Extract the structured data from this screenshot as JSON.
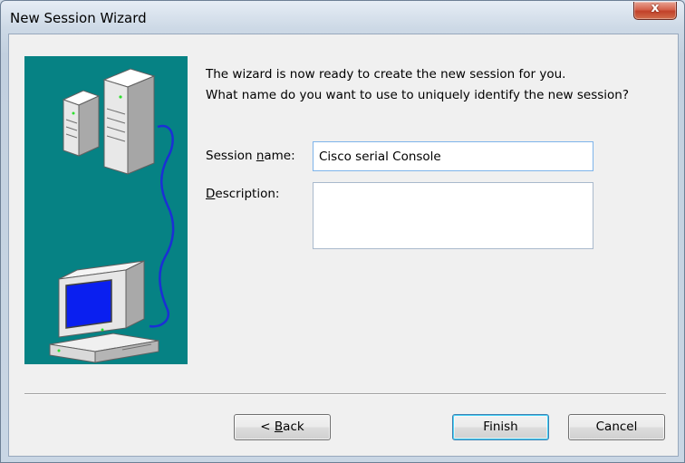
{
  "window": {
    "title": "New Session Wizard",
    "close_symbol": "x",
    "close_icon": "close-icon",
    "accent": "#c1412a"
  },
  "intro": {
    "line1": "The wizard is now ready to create the new session for you.",
    "line2": "What name do you want to use to uniquely identify the new session?"
  },
  "form": {
    "session_name_label_pre": "Session ",
    "session_name_label_ul": "n",
    "session_name_label_post": "ame:",
    "session_name_value": "Cisco serial Console",
    "description_label_ul": "D",
    "description_label_post": "escription:",
    "description_value": ""
  },
  "buttons": {
    "back_pre": "< ",
    "back_ul": "B",
    "back_post": "ack",
    "finish": "Finish",
    "cancel": "Cancel"
  },
  "illustration": {
    "icon": "server-computer-connection-illustration",
    "background": "#068284",
    "cable_color": "#1b2fd6",
    "screen_color": "#0a1ff0"
  }
}
